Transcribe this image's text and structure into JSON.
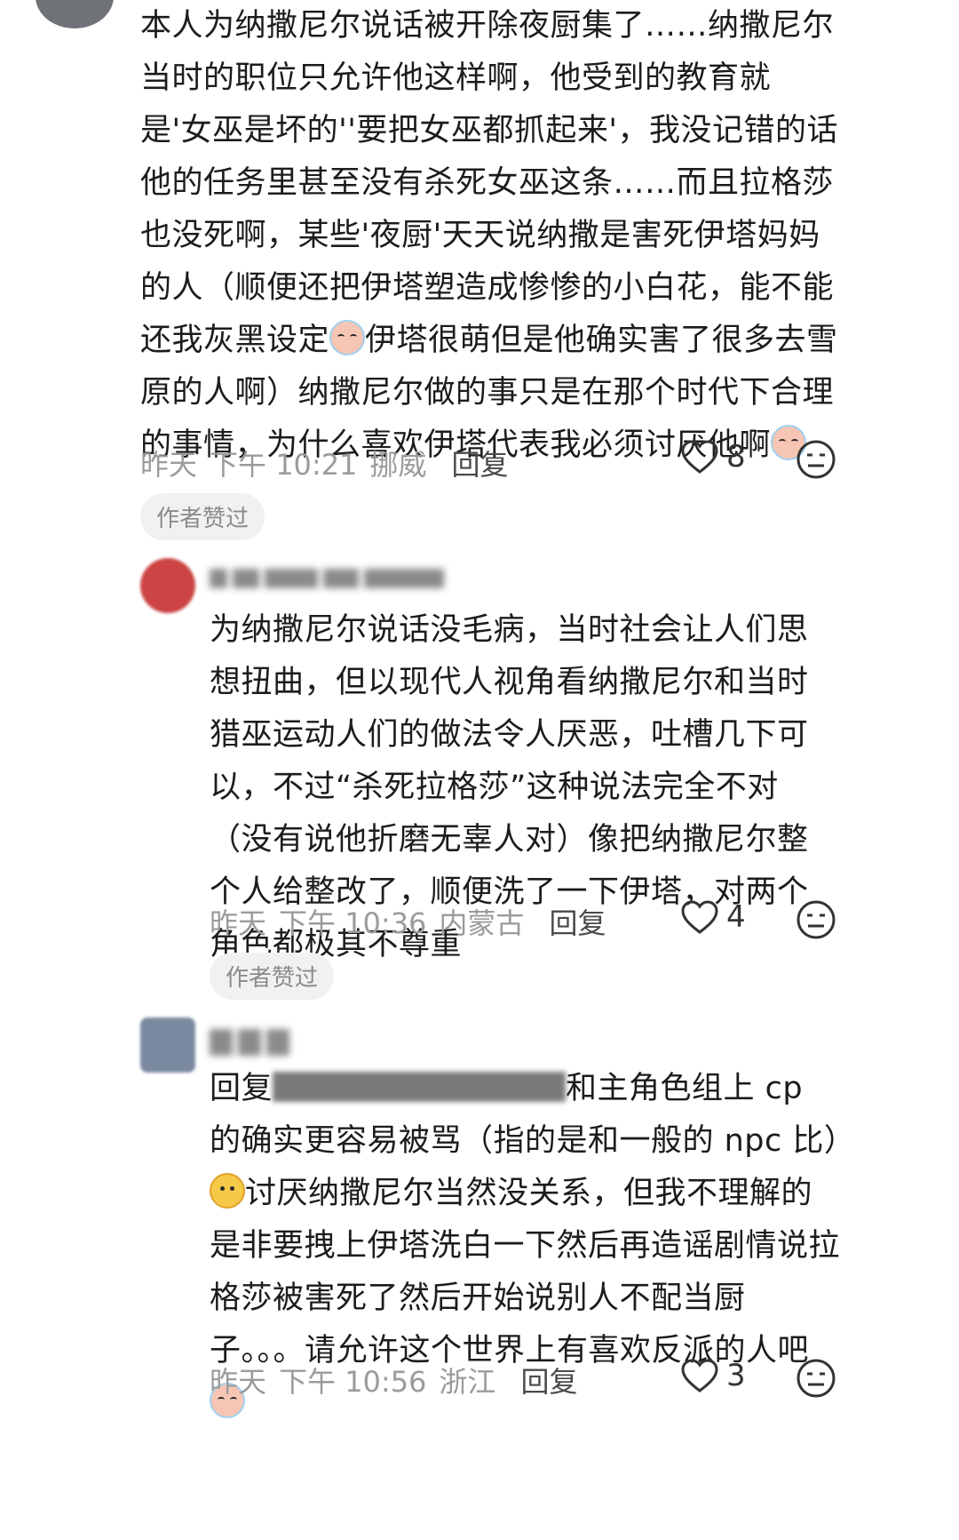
{
  "comments": [
    {
      "text_a": "本人为纳撒尼尔说话被开除夜厨集了……纳撒尼尔当时的职位只允许他这样啊，他受到的教育就是'女巫是坏的''要把女巫都抓起来'，我没记错的话他的任务里甚至没有杀死女巫这条……而且拉格莎也没死啊，某些'夜厨'天天说纳撒是害死伊塔妈妈的人（顺便还把伊塔塑造成惨惨的小白花，能不能还我灰黑设定",
      "text_b": "伊塔很萌但是他确实害了很多去雪原的人啊）纳撒尼尔做的事只是在那个时代下合理的事情，为什么喜欢伊塔代表我必须讨厌他啊",
      "date": "昨天",
      "time": "下午 10:21",
      "location": "挪威",
      "reply": "回复",
      "likes": "8",
      "badge": "作者赞过"
    },
    {
      "text": "为纳撒尼尔说话没毛病，当时社会让人们思想扭曲，但以现代人视角看纳撒尼尔和当时猎巫运动人们的做法令人厌恶，吐槽几下可以，不过“杀死拉格莎”这种说法完全不对（没有说他折磨无辜人对）像把纳撒尼尔整个人给整改了，顺便洗了一下伊塔，对两个角色都极其不尊重",
      "date": "昨天",
      "time": "下午 10:36",
      "location": "内蒙古",
      "reply": "回复",
      "likes": "4",
      "badge": "作者赞过"
    },
    {
      "prefix": "回复",
      "text_a": "和主角色组上 cp 的确实更容易被骂（指的是和一般的 npc 比）",
      "text_b": "讨厌纳撒尼尔当然没关系，但我不理解的是非要拽上伊塔洗白一下然后再造谣剧情说拉格莎被害死了然后开始说别人不配当厨子。。。请允许这个世界上有喜欢反派的人吧",
      "date": "昨天",
      "time": "下午 10:56",
      "location": "浙江",
      "reply": "回复",
      "likes": "3"
    }
  ],
  "icons": {
    "like": "heart-outline-icon",
    "dislike": "neutral-face-icon",
    "emoji_cry": "crying-face-emoji",
    "emoji_smile": "yellow-face-emoji"
  }
}
